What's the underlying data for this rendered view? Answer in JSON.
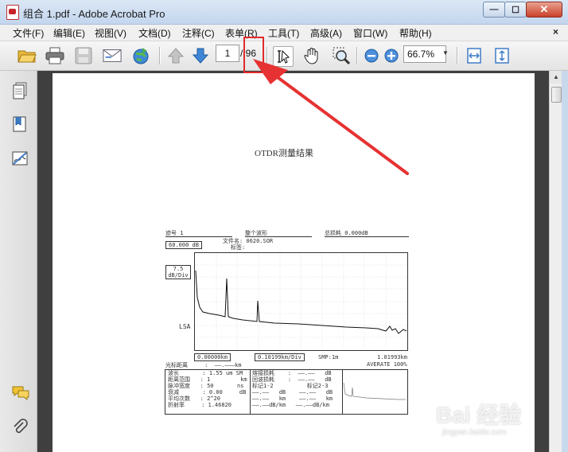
{
  "window": {
    "title": "组合 1.pdf - Adobe Acrobat Pro",
    "min": "—",
    "max": "☐",
    "close": "✕"
  },
  "menu": [
    "文件(F)",
    "编辑(E)",
    "视图(V)",
    "文档(D)",
    "注释(C)",
    "表单(R)",
    "工具(T)",
    "高级(A)",
    "窗口(W)",
    "帮助(H)"
  ],
  "menu_close": "×",
  "toolbar": {
    "page_current": "1",
    "page_total": "/ 96",
    "zoom": "66.7%"
  },
  "document": {
    "title": "OTDR测量结果",
    "header": {
      "curve_label": "迹号 1",
      "waveform_label": "整个波形",
      "total_loss": "总损耗 0.000dB"
    },
    "ref_level": "60.000 dB",
    "file_name": "文件名: 0620.SOR",
    "mark_label": "标签:",
    "scale": "7.5\ndB/Div",
    "lsa": "LSA",
    "cursor_start": "0.00000km",
    "cursor_div": "0.10199km/Div",
    "smp": "SMP:1m",
    "end_distance": "1.01993km",
    "averate": "AVERATE 100%",
    "cursor_row": "光标距离     :  ——.———km",
    "params_left": [
      "波长       : 1.55 um SM",
      "距离范围   : 1         km",
      "脉冲宽度   : 50       ns",
      "衰减       : 0.00     dB",
      "平均次数   : 2^20",
      "折射率     : 1.46820"
    ],
    "params_mid": [
      "熔接损耗    :  ——.——   dB",
      "回波损耗    :  ——.——   dB",
      "标记1-2          标记2-3",
      "——.——   dB    ——.——   dB",
      "——.——   km    ——.——   km",
      "——.——dB/km   ——.——dB/km"
    ]
  },
  "watermark": {
    "text": "Bai 经验",
    "sub": "jingyan.baidu.com"
  }
}
